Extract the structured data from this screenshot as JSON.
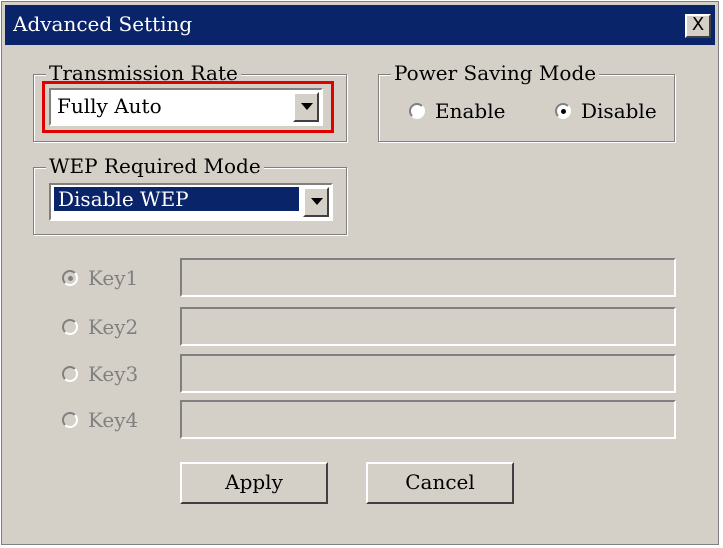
{
  "window": {
    "title": "Advanced Setting",
    "close_label": "X"
  },
  "transmission": {
    "legend": "Transmission Rate",
    "value": "Fully Auto"
  },
  "power": {
    "legend": "Power Saving Mode",
    "enable_label": "Enable",
    "disable_label": "Disable",
    "selected": "Disable"
  },
  "wep": {
    "legend": "WEP Required Mode",
    "value": "Disable WEP"
  },
  "keys": [
    {
      "label": "Key1",
      "value": "",
      "checked": true
    },
    {
      "label": "Key2",
      "value": "",
      "checked": false
    },
    {
      "label": "Key3",
      "value": "",
      "checked": false
    },
    {
      "label": "Key4",
      "value": "",
      "checked": false
    }
  ],
  "buttons": {
    "apply": "Apply",
    "cancel": "Cancel"
  },
  "colors": {
    "highlight": "#e00000",
    "titlebar": "#0a246a",
    "face": "#d4d0c8"
  }
}
